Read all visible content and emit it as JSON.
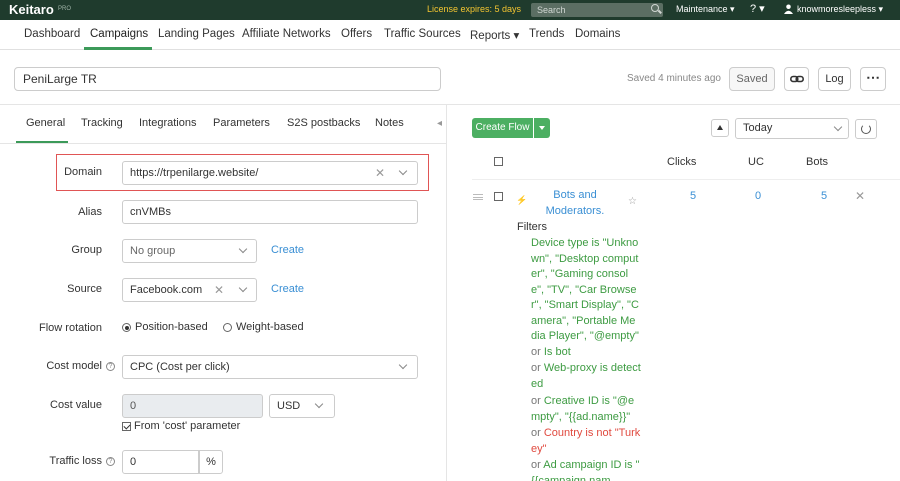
{
  "topbar": {
    "logo": "Keitaro",
    "logo_sub": "PRO",
    "license": "License expires: 5 days",
    "search_placeholder": "Search",
    "maintenance": "Maintenance ▾",
    "help": "? ▾",
    "user": "knowmoresleepless ▾"
  },
  "nav": {
    "items": [
      "Dashboard",
      "Campaigns",
      "Landing Pages",
      "Affiliate Networks",
      "Offers",
      "Traffic Sources",
      "Reports ▾",
      "Trends",
      "Domains"
    ]
  },
  "campaign": {
    "name": "PeniLarge TR",
    "saved_status": "Saved 4 minutes ago",
    "saved_label": "Saved",
    "log_label": "Log",
    "more_label": "⋯"
  },
  "tabs": [
    "General",
    "Tracking",
    "Integrations",
    "Parameters",
    "S2S postbacks",
    "Notes"
  ],
  "tabs_arrow": "◂",
  "form": {
    "domain_label": "Domain",
    "domain_value": "https://trpenilarge.website/",
    "alias_label": "Alias",
    "alias_value": "cnVMBs",
    "group_label": "Group",
    "group_value": "No group",
    "group_create": "Create",
    "source_label": "Source",
    "source_value": "Facebook.com",
    "source_create": "Create",
    "flow_rotation_label": "Flow rotation",
    "rotation_position": "Position-based",
    "rotation_weight": "Weight-based",
    "cost_model_label": "Cost model",
    "cost_model_value": "CPC (Cost per click)",
    "cost_value_label": "Cost value",
    "cost_value": "0",
    "currency": "USD",
    "cost_from_param": "From 'cost' parameter",
    "traffic_loss_label": "Traffic loss",
    "traffic_loss_value": "0",
    "percent": "%",
    "help_glyph": "?"
  },
  "flows": {
    "create_flow": "Create Flow",
    "date_range": "Today",
    "columns": [
      "Clicks",
      "UC",
      "Bots"
    ],
    "row": {
      "name": "Bots and Moderators.",
      "clicks": "5",
      "uc": "0",
      "bots": "5"
    },
    "filters_title": "Filters",
    "filters": [
      {
        "prefix": "",
        "text": "Device type is \"Unknown\", \"Desktop computer\", \"Gaming console\", \"TV\", \"Car Browser\", \"Smart Display\", \"Camera\", \"Portable Media Player\", \"@empty\"",
        "color": "green"
      },
      {
        "prefix": "or",
        "text": "Is bot",
        "color": "green"
      },
      {
        "prefix": "or",
        "text": "Web-proxy is detected",
        "color": "green"
      },
      {
        "prefix": "or",
        "text": "Creative ID is \"@empty\", \"{{ad.name}}\"",
        "color": "green"
      },
      {
        "prefix": "or",
        "text": "Country is not \"Turkey\"",
        "color": "red"
      },
      {
        "prefix": "or",
        "text": "Ad campaign ID is \"{{campaign.nam",
        "color": "green"
      }
    ]
  },
  "colors": {
    "topbar_bg": "#1f3b2d",
    "accent_green": "#4caf62",
    "link_blue": "#3a8fd4",
    "license_yellow": "#f4c531",
    "highlight_red": "#e05555"
  }
}
